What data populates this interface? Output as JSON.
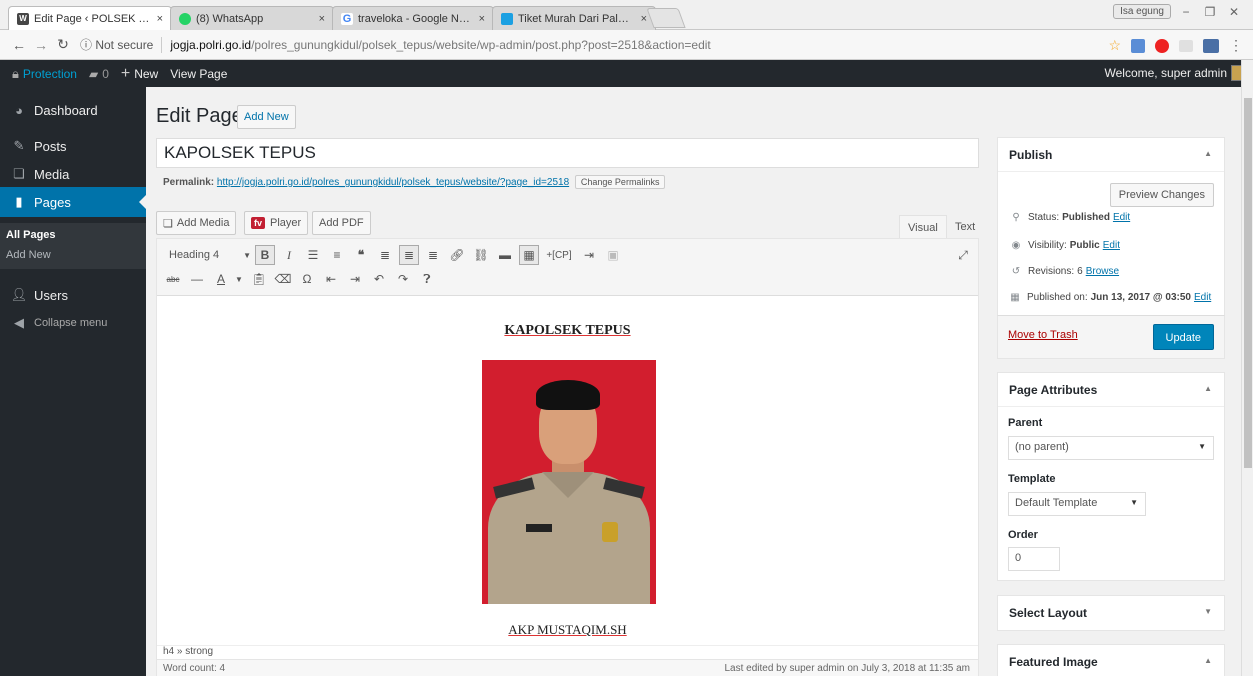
{
  "browser": {
    "tabs": [
      {
        "label": "Edit Page ‹ POLSEK TEPU",
        "close": "×",
        "active": true,
        "fav_color": "#464646"
      },
      {
        "label": "(8) WhatsApp",
        "close": "×",
        "active": false,
        "fav_color": "#25d366"
      },
      {
        "label": "traveloka - Google Nggo",
        "close": "×",
        "active": false,
        "fav_color": "#4285f4"
      },
      {
        "label": "Tiket Murah Dari Palu ke",
        "close": "×",
        "active": false,
        "fav_color": "#1ba0e2"
      }
    ],
    "profile": "Isa egung",
    "address": {
      "security": "ⓘ Not secure",
      "host": "jogja.polri.go.id",
      "path": "/polres_gunungkidul/polsek_tepus/website/wp-admin/post.php?post=2518&action=edit"
    }
  },
  "adminbar": {
    "site": "Protection",
    "comments": "0",
    "new": "New",
    "view": "View Page",
    "welcome": "Welcome, super admin"
  },
  "sidebar": {
    "items": [
      {
        "label": "Dashboard",
        "icon": "dashboard-icon"
      },
      {
        "label": "Posts",
        "icon": "pin-icon"
      },
      {
        "label": "Media",
        "icon": "media-icon"
      },
      {
        "label": "Pages",
        "icon": "pages-icon"
      },
      {
        "label": "Users",
        "icon": "users-icon"
      },
      {
        "label": "Collapse menu",
        "icon": "collapse-icon"
      }
    ],
    "sub": [
      "All Pages",
      "Add New"
    ]
  },
  "editor": {
    "heading": "Edit Page",
    "add_new": "Add New",
    "title": "KAPOLSEK TEPUS",
    "permalink_label": "Permalink:",
    "permalink_url": "http://jogja.polri.go.id/polres_gunungkidul/polsek_tepus/website/?page_id=2518",
    "change_permalinks": "Change Permalinks",
    "add_media": "Add Media",
    "player_icon": "fv",
    "player": "Player",
    "add_pdf": "Add PDF",
    "visual_tab": "Visual",
    "text_tab": "Text",
    "format": "Heading 4",
    "content_title": "KAPOLSEK TEPUS",
    "content_name": "AKP MUSTAQIM.SH",
    "path": "h4 » strong",
    "word_count": "Word count: 4",
    "last_edited": "Last edited by super admin on July 3, 2018 at 11:35 am",
    "cp_button": "+[CP]"
  },
  "publish": {
    "title": "Publish",
    "preview": "Preview Changes",
    "status_label": "Status:",
    "status": "Published",
    "visibility_label": "Visibility:",
    "visibility": "Public",
    "revisions_label": "Revisions:",
    "revisions": "6",
    "browse": "Browse",
    "published_label": "Published on:",
    "published": "Jun 13, 2017 @ 03:50",
    "edit": "Edit",
    "trash": "Move to Trash",
    "update": "Update"
  },
  "attributes": {
    "title": "Page Attributes",
    "parent_label": "Parent",
    "parent": "(no parent)",
    "template_label": "Template",
    "template": "Default Template",
    "order_label": "Order",
    "order": "0"
  },
  "layout_box": {
    "title": "Select Layout"
  },
  "featured_box": {
    "title": "Featured Image"
  }
}
